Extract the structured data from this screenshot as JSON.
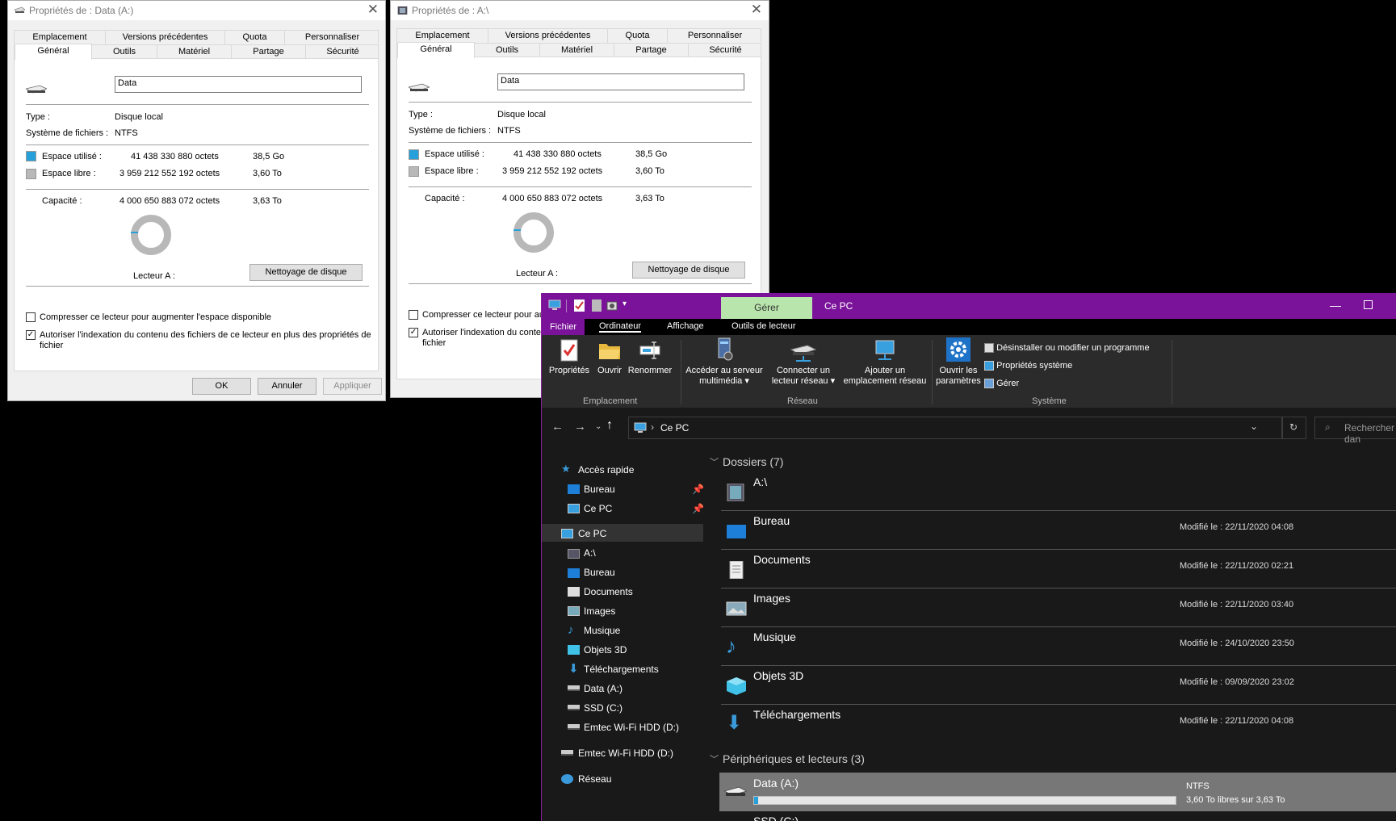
{
  "dialog1": {
    "title": "Propriétés de : Data (A:)",
    "tabs_top": [
      "Emplacement",
      "Versions précédentes",
      "Quota",
      "Personnaliser"
    ],
    "tabs_bottom": [
      "Général",
      "Outils",
      "Matériel",
      "Partage",
      "Sécurité"
    ],
    "name_value": "Data",
    "type_label": "Type :",
    "type_value": "Disque local",
    "fs_label": "Système de fichiers :",
    "fs_value": "NTFS",
    "used_label": "Espace utilisé :",
    "used_bytes": "41 438 330 880 octets",
    "used_human": "38,5 Go",
    "free_label": "Espace libre :",
    "free_bytes": "3 959 212 552 192 octets",
    "free_human": "3,60 To",
    "cap_label": "Capacité :",
    "cap_bytes": "4 000 650 883 072 octets",
    "cap_human": "3,63 To",
    "drive_label": "Lecteur A :",
    "cleanup": "Nettoyage de disque",
    "compress": "Compresser ce lecteur pour augmenter l'espace disponible",
    "index1": "Autoriser l'indexation du contenu des fichiers de ce lecteur en plus des propriétés de",
    "index2": "fichier",
    "ok": "OK",
    "cancel": "Annuler",
    "apply": "Appliquer"
  },
  "dialog2": {
    "title": "Propriétés de : A:\\",
    "tabs_top": [
      "Emplacement",
      "Versions précédentes",
      "Quota",
      "Personnaliser"
    ],
    "tabs_bottom": [
      "Général",
      "Outils",
      "Matériel",
      "Partage",
      "Sécurité"
    ],
    "name_value": "Data",
    "type_label": "Type :",
    "type_value": "Disque local",
    "fs_label": "Système de fichiers :",
    "fs_value": "NTFS",
    "used_label": "Espace utilisé :",
    "used_bytes": "41 438 330 880 octets",
    "used_human": "38,5 Go",
    "free_label": "Espace libre :",
    "free_bytes": "3 959 212 552 192 octets",
    "free_human": "3,60 To",
    "cap_label": "Capacité :",
    "cap_bytes": "4 000 650 883 072 octets",
    "cap_human": "3,63 To",
    "drive_label": "Lecteur A :",
    "cleanup": "Nettoyage de disque",
    "compress": "Compresser ce lecteur pour aug",
    "index1": "Autoriser l'indexation du conten",
    "index2": "fichier"
  },
  "explorer": {
    "context_tab": "Gérer",
    "title": "Ce PC",
    "ribbon_tabs": [
      "Fichier",
      "Ordinateur",
      "Affichage",
      "Outils de lecteur"
    ],
    "cmds": {
      "props": "Propriétés",
      "open": "Ouvrir",
      "rename": "Renommer",
      "media1": "Accéder au serveur",
      "media2": "multimédia",
      "map1": "Connecter un",
      "map2": "lecteur réseau",
      "addloc1": "Ajouter un",
      "addloc2": "emplacement réseau",
      "settings1": "Ouvrir les",
      "settings2": "paramètres",
      "uninstall": "Désinstaller ou modifier un programme",
      "sysprops": "Propriétés système",
      "manage": "Gérer"
    },
    "groups": [
      "Emplacement",
      "Réseau",
      "Système"
    ],
    "address": "Ce PC",
    "search_placeholder": "Rechercher dan",
    "nav": {
      "quick": "Accès rapide",
      "quick_items": [
        "Bureau",
        "Ce PC"
      ],
      "thispc": "Ce PC",
      "pc_items": [
        "A:\\",
        "Bureau",
        "Documents",
        "Images",
        "Musique",
        "Objets 3D",
        "Téléchargements",
        "Data (A:)",
        "SSD (C:)",
        "Emtec Wi-Fi HDD (D:)"
      ],
      "emtec": "Emtec Wi-Fi HDD (D:)",
      "network": "Réseau"
    },
    "folders_header": "Dossiers (7)",
    "folders": [
      {
        "name": "A:\\",
        "modified": ""
      },
      {
        "name": "Bureau",
        "modified": "Modifié le : 22/11/2020 04:08"
      },
      {
        "name": "Documents",
        "modified": "Modifié le : 22/11/2020 02:21"
      },
      {
        "name": "Images",
        "modified": "Modifié le : 22/11/2020 03:40"
      },
      {
        "name": "Musique",
        "modified": "Modifié le : 24/10/2020 23:50"
      },
      {
        "name": "Objets 3D",
        "modified": "Modifié le : 09/09/2020 23:02"
      },
      {
        "name": "Téléchargements",
        "modified": "Modifié le : 22/11/2020 04:08"
      }
    ],
    "devices_header": "Périphériques et lecteurs (3)",
    "drive": {
      "name": "Data (A:)",
      "fs": "NTFS",
      "free": "3,60 To libres sur 3,63 To",
      "used_fraction": 0.01
    },
    "next_drive_partial": "SSD (C:)"
  },
  "colors": {
    "used": "#26a0da",
    "free": "#b8b8b8",
    "titlebar": "#7a129a",
    "gerer": "#b8e5ac"
  }
}
